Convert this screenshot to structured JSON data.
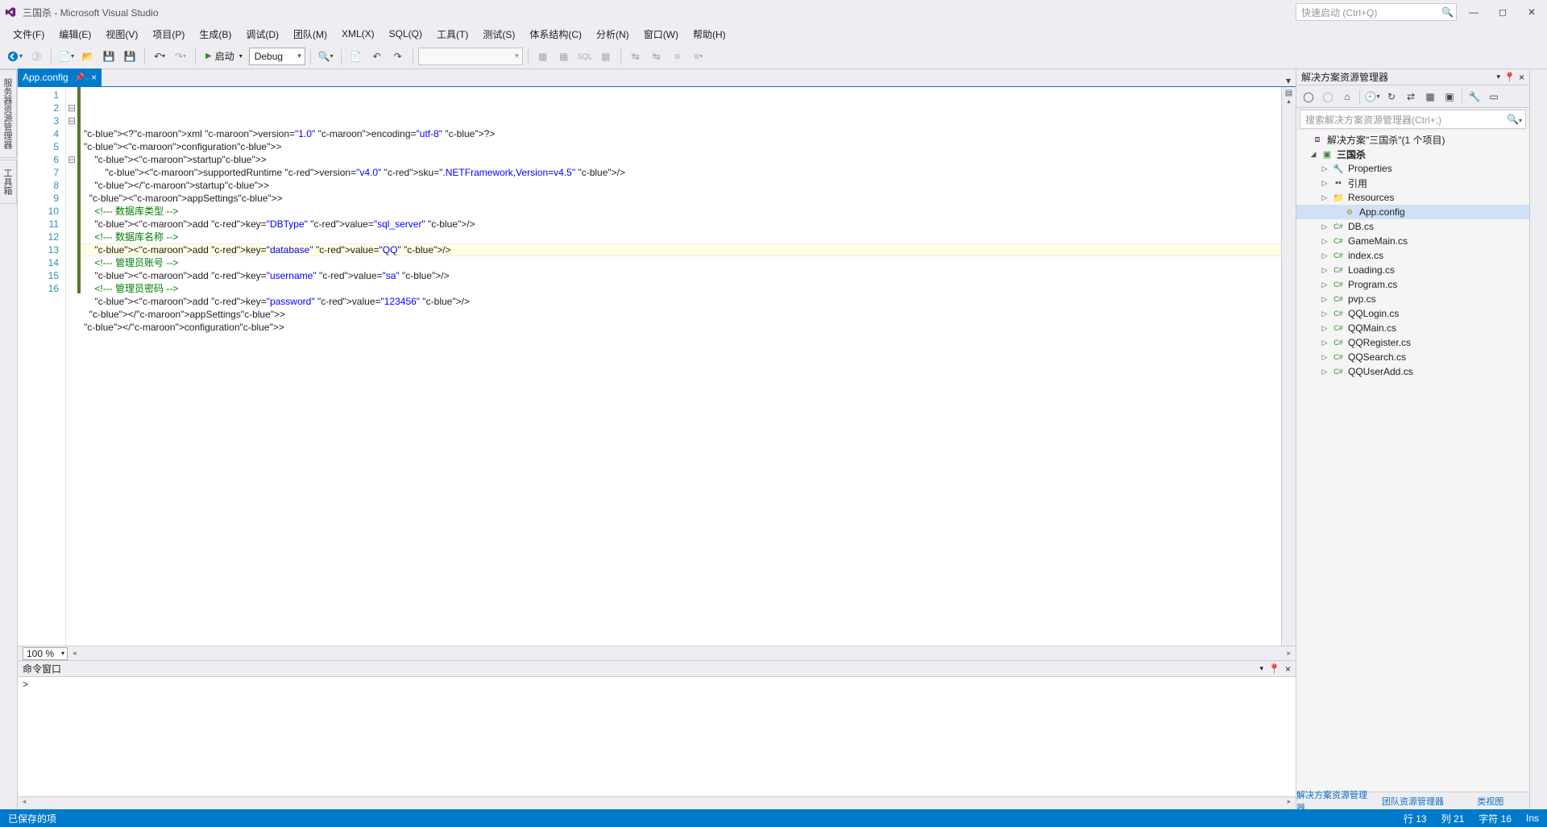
{
  "title": "三国杀 - Microsoft Visual Studio",
  "quick_launch_placeholder": "快速启动 (Ctrl+Q)",
  "menu": [
    "文件(F)",
    "编辑(E)",
    "视图(V)",
    "项目(P)",
    "生成(B)",
    "调试(D)",
    "团队(M)",
    "XML(X)",
    "SQL(Q)",
    "工具(T)",
    "测试(S)",
    "体系结构(C)",
    "分析(N)",
    "窗口(W)",
    "帮助(H)"
  ],
  "toolbar": {
    "start": "启动",
    "config": "Debug"
  },
  "vtabs": [
    "服务器资源管理器",
    "工具箱"
  ],
  "doc_tab": {
    "name": "App.config"
  },
  "zoom": "100 %",
  "code_lines": [
    "<?xml version=\"1.0\" encoding=\"utf-8\" ?>",
    "<configuration>",
    "    <startup>",
    "        <supportedRuntime version=\"v4.0\" sku=\".NETFramework,Version=v4.5\" />",
    "    </startup>",
    "  <appSettings>",
    "    <!--- 数据库类型 -->",
    "    <add key=\"DBType\" value=\"sql_server\" />",
    "    <!--- 数据库名称 -->",
    "    <add key=\"database\" value=\"QQ\" />",
    "    <!--- 管理员账号 -->",
    "    <add key=\"username\" value=\"sa\" />",
    "    <!--- 管理员密码 -->",
    "    <add key=\"password\" value=\"123456\" />",
    "  </appSettings>",
    "</configuration>"
  ],
  "cmd_window_title": "命令窗口",
  "cmd_prompt": ">",
  "solution_explorer": {
    "title": "解决方案资源管理器",
    "search_placeholder": "搜索解决方案资源管理器(Ctrl+;)",
    "solution_label": "解决方案\"三国杀\"(1 个项目)",
    "project": "三国杀",
    "nodes": {
      "properties": "Properties",
      "references": "引用",
      "resources": "Resources",
      "files": [
        "App.config",
        "DB.cs",
        "GameMain.cs",
        "index.cs",
        "Loading.cs",
        "Program.cs",
        "pvp.cs",
        "QQLogin.cs",
        "QQMain.cs",
        "QQRegister.cs",
        "QQSearch.cs",
        "QQUserAdd.cs"
      ]
    },
    "tabs": [
      "解决方案资源管理器",
      "团队资源管理器",
      "类视图"
    ]
  },
  "status": {
    "saved": "已保存的项",
    "line": "行 13",
    "col": "列 21",
    "char": "字符 16",
    "ins": "Ins"
  }
}
